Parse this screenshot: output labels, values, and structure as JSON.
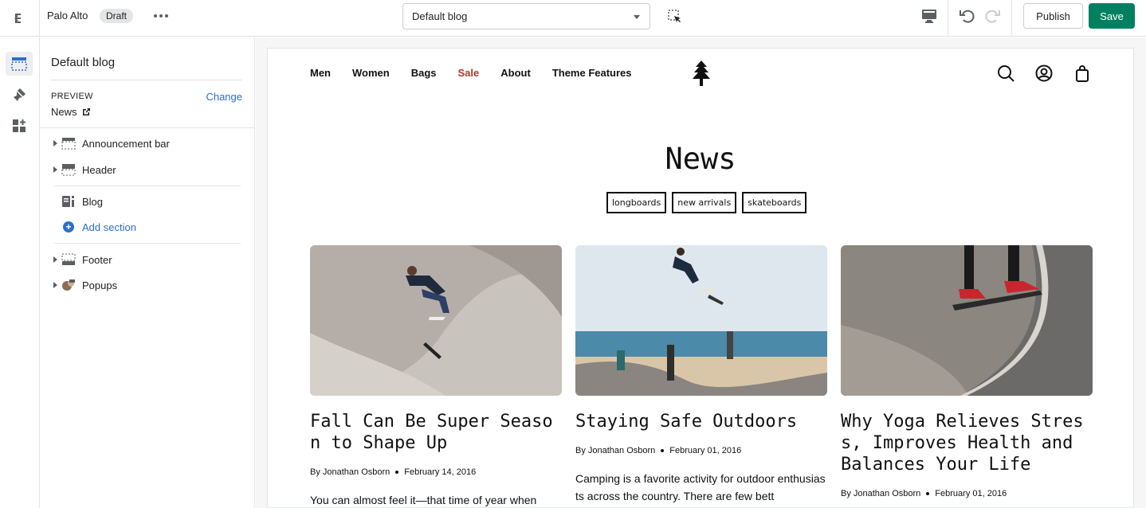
{
  "topbar": {
    "store_name": "Palo Alto",
    "status_badge": "Draft",
    "template_select": "Default blog",
    "publish_label": "Publish",
    "save_label": "Save"
  },
  "sidebar": {
    "title": "Default blog",
    "preview_label": "PREVIEW",
    "change_label": "Change",
    "preview_page": "News",
    "items": [
      {
        "label": "Announcement bar"
      },
      {
        "label": "Header"
      },
      {
        "label": "Blog"
      },
      {
        "label": "Add section"
      },
      {
        "label": "Footer"
      },
      {
        "label": "Popups"
      }
    ]
  },
  "store": {
    "nav": [
      "Men",
      "Women",
      "Bags",
      "Sale",
      "About",
      "Theme Features"
    ],
    "page_title": "News",
    "tags": [
      "longboards",
      "new arrivals",
      "skateboards"
    ],
    "posts": [
      {
        "title": "Fall Can Be Super Season to Shape Up",
        "author": "By Jonathan Osborn",
        "date": "February 14, 2016",
        "excerpt": "You can almost feel it—that time of year when"
      },
      {
        "title": "Staying Safe Outdoors",
        "author": "By Jonathan Osborn",
        "date": "February 01, 2016",
        "excerpt": "Camping is a favorite activity for outdoor enthusiasts across the country. There are few bett"
      },
      {
        "title": "Why Yoga Relieves Stress, Improves Health and Balances Your Life",
        "author": "By Jonathan Osborn",
        "date": "February 01, 2016"
      }
    ]
  },
  "colors": {
    "accent_green": "#008060",
    "link_blue": "#2c6ecb",
    "sale_red": "#b0392b"
  }
}
